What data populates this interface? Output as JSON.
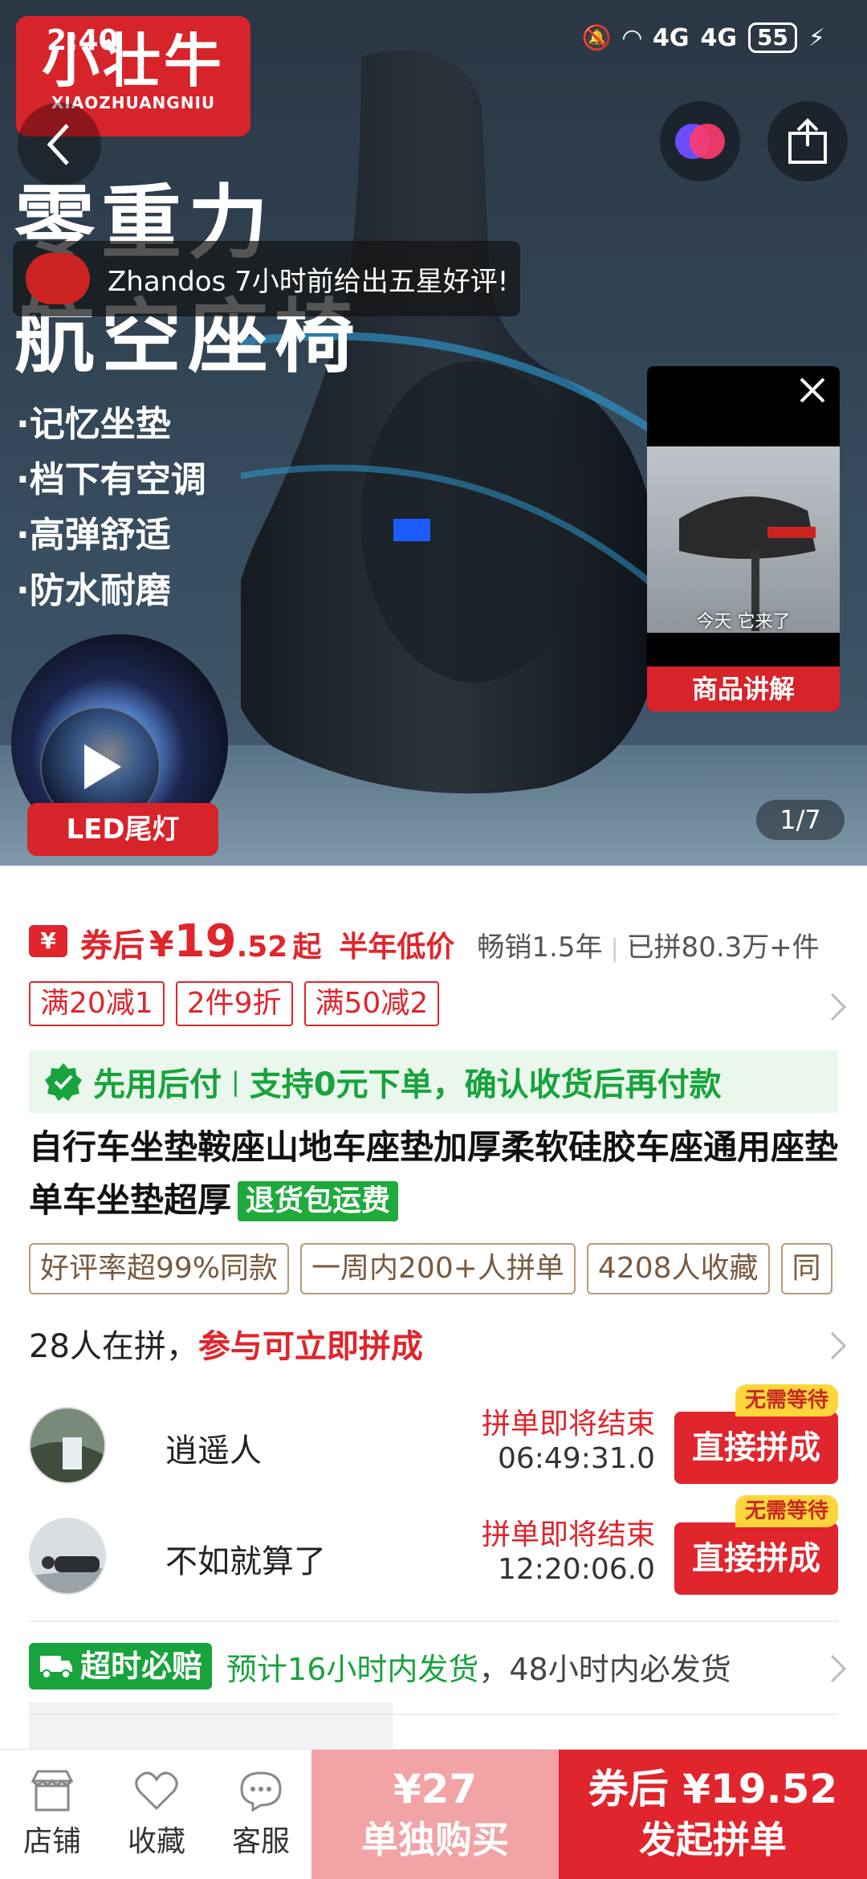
{
  "status_bar": {
    "time": "2:40",
    "signal1": "4G",
    "signal2": "4G",
    "battery": "55"
  },
  "brand": {
    "cn": "小壮牛",
    "en": "XIAOZHUANGNIU"
  },
  "hero": {
    "headline1": "零重力",
    "headline2": "航空座椅",
    "review_toast": "Zhandos 7小时前给出五星好评!",
    "features": [
      "·记忆坐垫",
      "·档下有空调",
      "·高弹舒适",
      "·防水耐磨"
    ],
    "led_label": "LED尾灯",
    "page_indicator": "1/7",
    "mini_video": {
      "caption": "今天 它来了",
      "label": "商品讲解"
    }
  },
  "price": {
    "coupon_icon": "¥",
    "prefix": "券后",
    "yen": "¥",
    "integer": "19",
    "decimal": ".52",
    "suffix": "起",
    "low_tag": "半年低价",
    "sold_time": "畅销1.5年",
    "sold_count": "已拼80.3万+件"
  },
  "promos": [
    "满20减1",
    "2件9折",
    "满50减2"
  ],
  "pay_later": {
    "title": "先用后付",
    "desc": "支持0元下单，确认收货后再付款"
  },
  "product": {
    "title": "自行车坐垫鞍座山地车座垫加厚柔软硅胶车座通用座垫单车坐垫超厚",
    "return_badge": "退货包运费"
  },
  "highlights": [
    "好评率超99%同款",
    "一周内200+人拼单",
    "4208人收藏",
    "同"
  ],
  "group": {
    "count_text": "28人在拼，",
    "cta_text": "参与可立即拼成",
    "items": [
      {
        "name": "逍遥人",
        "ending": "拼单即将结束",
        "timer": "06:49:31.0",
        "join": "直接拼成",
        "badge": "无需等待"
      },
      {
        "name": "不如就算了",
        "ending": "拼单即将结束",
        "timer": "12:20:06.0",
        "join": "直接拼成",
        "badge": "无需等待"
      }
    ]
  },
  "shipping": {
    "badge": "超时必赔",
    "green": "预计16小时内发货",
    "gray": "，48小时内必发货"
  },
  "bottom": {
    "store": "店铺",
    "favorite": "收藏",
    "service": "客服",
    "single_price": "¥27",
    "single_label": "单独购买",
    "group_price": "券后 ¥19.52",
    "group_label": "发起拼单"
  },
  "colors": {
    "accent_red": "#e0252c",
    "green": "#18a33c",
    "light_red": "#f2a3a5"
  }
}
